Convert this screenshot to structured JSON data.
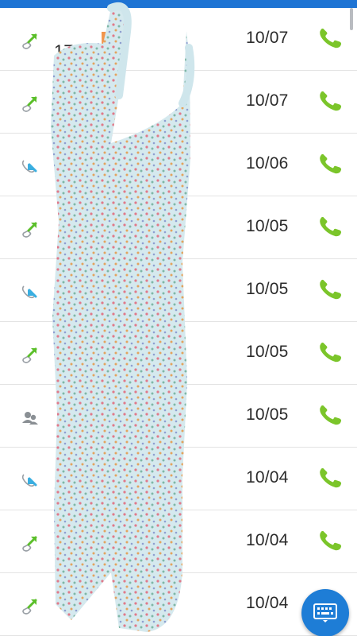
{
  "colors": {
    "accent": "#1e74d4",
    "dial_green": "#7bc52a",
    "outgoing_arrow": "#5bbf2a",
    "incoming_arrow": "#3aaee0",
    "divider": "#e3e3e3",
    "scribble_fill": "#d5e9ee"
  },
  "call_log": [
    {
      "type_icon": "outgoing-call-icon",
      "date": "10/07",
      "visible_text": "1705",
      "action_icon": "phone-icon"
    },
    {
      "type_icon": "outgoing-call-icon",
      "date": "10/07",
      "visible_text": "",
      "action_icon": "phone-icon"
    },
    {
      "type_icon": "incoming-call-icon",
      "date": "10/06",
      "visible_text": "",
      "action_icon": "phone-icon"
    },
    {
      "type_icon": "outgoing-call-icon",
      "date": "10/05",
      "visible_text": "",
      "action_icon": "phone-icon"
    },
    {
      "type_icon": "incoming-call-icon",
      "date": "10/05",
      "visible_text": "",
      "action_icon": "phone-icon"
    },
    {
      "type_icon": "outgoing-call-icon",
      "date": "10/05",
      "visible_text": "",
      "action_icon": "phone-icon"
    },
    {
      "type_icon": "contact-group-icon",
      "date": "10/05",
      "visible_text": "",
      "action_icon": "phone-icon"
    },
    {
      "type_icon": "incoming-call-icon",
      "date": "10/04",
      "visible_text": "",
      "action_icon": "phone-icon"
    },
    {
      "type_icon": "outgoing-call-icon",
      "date": "10/04",
      "visible_text": "",
      "action_icon": "phone-icon"
    },
    {
      "type_icon": "outgoing-call-icon",
      "date": "10/04",
      "visible_text": "",
      "action_icon": "phone-icon"
    }
  ],
  "fab": {
    "icon": "dialpad-keyboard-icon"
  }
}
